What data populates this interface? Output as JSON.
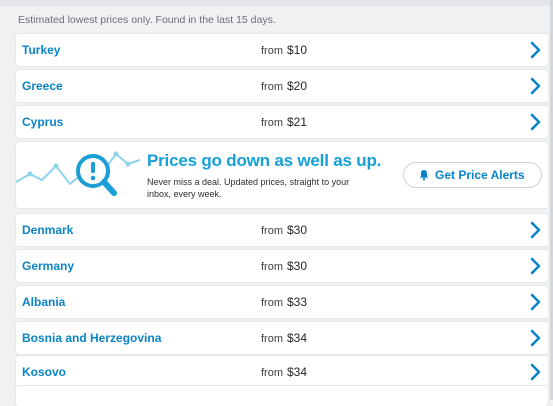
{
  "note": "Estimated lowest prices only. Found in the last 15 days.",
  "from_label": "from",
  "destinations": [
    {
      "country": "Turkey",
      "price": "$10"
    },
    {
      "country": "Greece",
      "price": "$20"
    },
    {
      "country": "Cyprus",
      "price": "$21"
    },
    {
      "country": "Denmark",
      "price": "$30"
    },
    {
      "country": "Germany",
      "price": "$30"
    },
    {
      "country": "Albania",
      "price": "$33"
    },
    {
      "country": "Bosnia and Herzegovina",
      "price": "$34"
    },
    {
      "country": "Kosovo",
      "price": "$34"
    }
  ],
  "alert_card": {
    "headline": "Prices go down as well as up.",
    "subtext": "Never miss a deal. Updated prices, straight to your inbox, every week.",
    "button_label": "Get Price Alerts",
    "button_icon": "bell-icon",
    "illustration_icon": "magnifier-alert-icon"
  },
  "row_icon": "chevron-right-icon",
  "colors": {
    "link": "#0a84c8",
    "headline": "#15a0d8",
    "background": "#f0f1f3"
  }
}
